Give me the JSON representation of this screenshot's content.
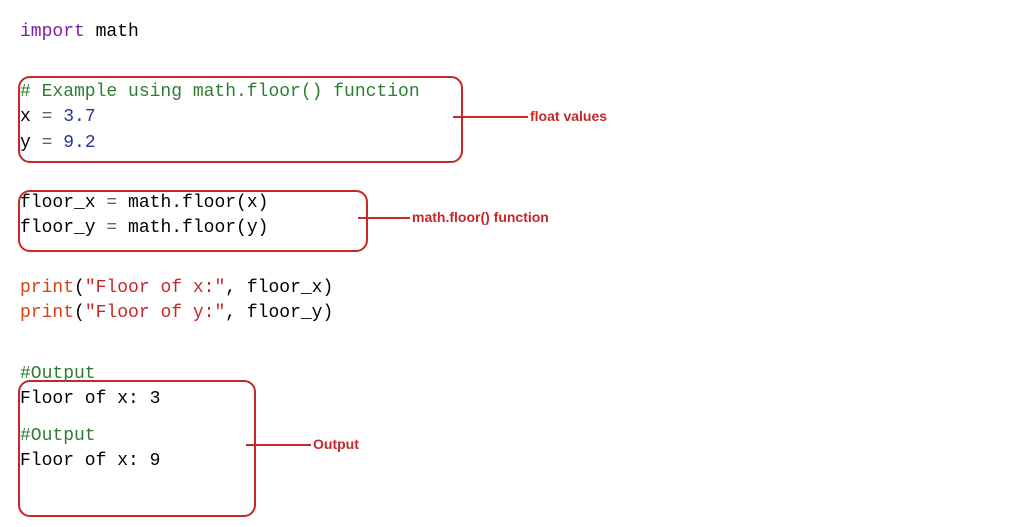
{
  "line1": {
    "import": "import",
    "math": " math"
  },
  "block1": {
    "comment": "# Example using math.floor() function",
    "line2_a": "x ",
    "line2_b": "=",
    "line2_c": " 3.7",
    "line3_a": "y ",
    "line3_b": "=",
    "line3_c": " 9.2"
  },
  "block2": {
    "line1_a": "floor_x ",
    "line1_b": "=",
    "line1_c": " math.floor(x)",
    "line2_a": "floor_y ",
    "line2_b": "=",
    "line2_c": " math.floor(y)"
  },
  "block3": {
    "line1_a": "print",
    "line1_b": "(",
    "line1_c": "\"Floor of x:\"",
    "line1_d": ", floor_x)",
    "line2_a": "print",
    "line2_b": "(",
    "line2_c": "\"Floor of y:\"",
    "line2_d": ", floor_y)"
  },
  "block4": {
    "comment1": "#Output",
    "out1": "Floor of x: 3",
    "comment2": "#Output",
    "out2": "Floor of x: 9"
  },
  "annotations": {
    "label1": "float values",
    "label2": "math.floor() function",
    "label3": "Output"
  }
}
